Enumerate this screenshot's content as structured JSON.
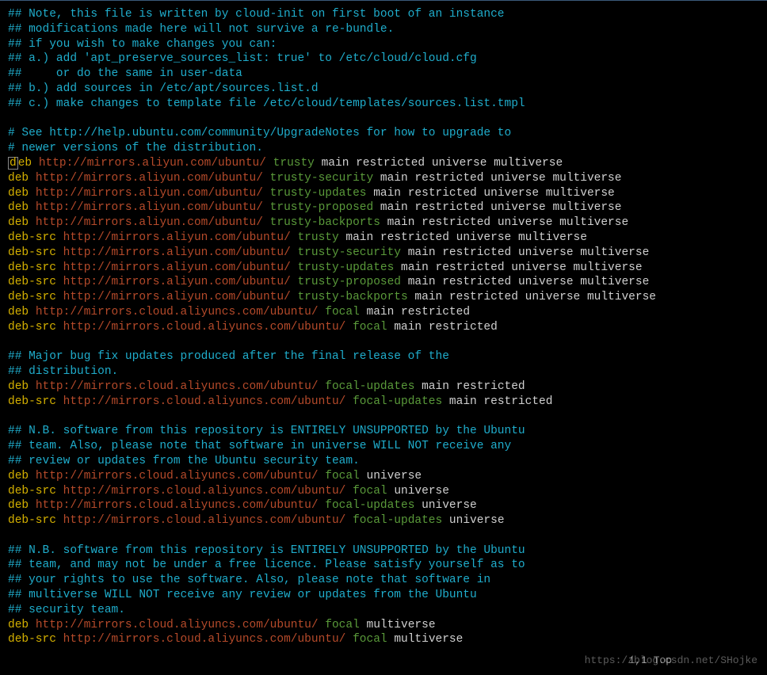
{
  "comments": {
    "header": [
      "## Note, this file is written by cloud-init on first boot of an instance",
      "## modifications made here will not survive a re-bundle.",
      "## if you wish to make changes you can:",
      "## a.) add 'apt_preserve_sources_list: true' to /etc/cloud/cloud.cfg",
      "##     or do the same in user-data",
      "## b.) add sources in /etc/apt/sources.list.d",
      "## c.) make changes to template file /etc/cloud/templates/sources.list.tmpl"
    ],
    "see": [
      "# See http://help.ubuntu.com/community/UpgradeNotes for how to upgrade to",
      "# newer versions of the distribution."
    ],
    "major": [
      "## Major bug fix updates produced after the final release of the",
      "## distribution."
    ],
    "nb1": [
      "## N.B. software from this repository is ENTIRELY UNSUPPORTED by the Ubuntu",
      "## team. Also, please note that software in universe WILL NOT receive any",
      "## review or updates from the Ubuntu security team."
    ],
    "nb2": [
      "## N.B. software from this repository is ENTIRELY UNSUPPORTED by the Ubuntu",
      "## team, and may not be under a free licence. Please satisfy yourself as to",
      "## your rights to use the software. Also, please note that software in",
      "## multiverse WILL NOT receive any review or updates from the Ubuntu",
      "## security team."
    ]
  },
  "lines": [
    {
      "type": "deb",
      "url": "http://mirrors.aliyun.com/ubuntu/",
      "rel": "trusty",
      "comp": "main restricted universe multiverse",
      "cursor": true
    },
    {
      "type": "deb",
      "url": "http://mirrors.aliyun.com/ubuntu/",
      "rel": "trusty-security",
      "comp": "main restricted universe multiverse"
    },
    {
      "type": "deb",
      "url": "http://mirrors.aliyun.com/ubuntu/",
      "rel": "trusty-updates",
      "comp": "main restricted universe multiverse"
    },
    {
      "type": "deb",
      "url": "http://mirrors.aliyun.com/ubuntu/",
      "rel": "trusty-proposed",
      "comp": "main restricted universe multiverse"
    },
    {
      "type": "deb",
      "url": "http://mirrors.aliyun.com/ubuntu/",
      "rel": "trusty-backports",
      "comp": "main restricted universe multiverse"
    },
    {
      "type": "deb-src",
      "url": "http://mirrors.aliyun.com/ubuntu/",
      "rel": "trusty",
      "comp": "main restricted universe multiverse"
    },
    {
      "type": "deb-src",
      "url": "http://mirrors.aliyun.com/ubuntu/",
      "rel": "trusty-security",
      "comp": "main restricted universe multiverse"
    },
    {
      "type": "deb-src",
      "url": "http://mirrors.aliyun.com/ubuntu/",
      "rel": "trusty-updates",
      "comp": "main restricted universe multiverse"
    },
    {
      "type": "deb-src",
      "url": "http://mirrors.aliyun.com/ubuntu/",
      "rel": "trusty-proposed",
      "comp": "main restricted universe multiverse"
    },
    {
      "type": "deb-src",
      "url": "http://mirrors.aliyun.com/ubuntu/",
      "rel": "trusty-backports",
      "comp": "main restricted universe multiverse"
    },
    {
      "type": "deb",
      "url": "http://mirrors.cloud.aliyuncs.com/ubuntu/",
      "rel": "focal",
      "comp": "main restricted"
    },
    {
      "type": "deb-src",
      "url": "http://mirrors.cloud.aliyuncs.com/ubuntu/",
      "rel": "focal",
      "comp": "main restricted"
    }
  ],
  "lines_major": [
    {
      "type": "deb",
      "url": "http://mirrors.cloud.aliyuncs.com/ubuntu/",
      "rel": "focal-updates",
      "comp": "main restricted"
    },
    {
      "type": "deb-src",
      "url": "http://mirrors.cloud.aliyuncs.com/ubuntu/",
      "rel": "focal-updates",
      "comp": "main restricted"
    }
  ],
  "lines_nb1": [
    {
      "type": "deb",
      "url": "http://mirrors.cloud.aliyuncs.com/ubuntu/",
      "rel": "focal",
      "comp": "universe"
    },
    {
      "type": "deb-src",
      "url": "http://mirrors.cloud.aliyuncs.com/ubuntu/",
      "rel": "focal",
      "comp": "universe"
    },
    {
      "type": "deb",
      "url": "http://mirrors.cloud.aliyuncs.com/ubuntu/",
      "rel": "focal-updates",
      "comp": "universe"
    },
    {
      "type": "deb-src",
      "url": "http://mirrors.cloud.aliyuncs.com/ubuntu/",
      "rel": "focal-updates",
      "comp": "universe"
    }
  ],
  "lines_nb2": [
    {
      "type": "deb",
      "url": "http://mirrors.cloud.aliyuncs.com/ubuntu/",
      "rel": "focal",
      "comp": "multiverse"
    },
    {
      "type": "deb-src",
      "url": "http://mirrors.cloud.aliyuncs.com/ubuntu/",
      "rel": "focal",
      "comp": "multiverse"
    }
  ],
  "status": "1,1",
  "status_right": "Top",
  "watermark": "https://blog.csdn.net/SHojke"
}
